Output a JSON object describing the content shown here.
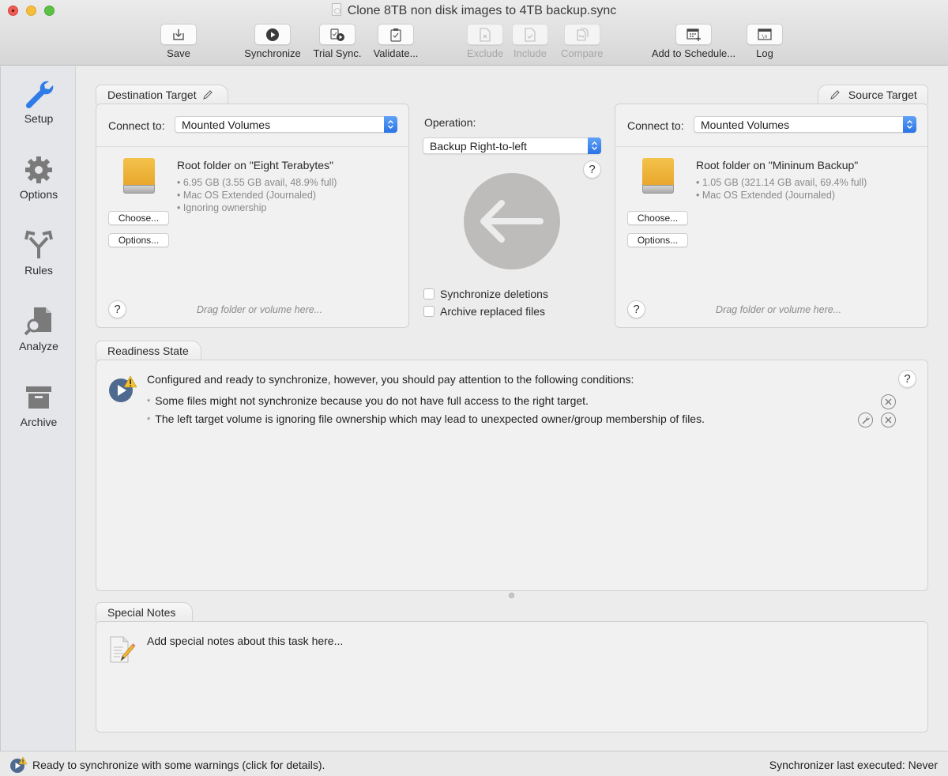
{
  "window": {
    "title": "Clone 8TB non disk images to 4TB backup.sync"
  },
  "toolbar": {
    "items": [
      {
        "label": "Save",
        "icon": "save-icon",
        "enabled": true
      },
      {
        "label": "Synchronize",
        "icon": "play-circle-icon",
        "enabled": true
      },
      {
        "label": "Trial Sync.",
        "icon": "trial-sync-icon",
        "enabled": true
      },
      {
        "label": "Validate...",
        "icon": "clipboard-check-icon",
        "enabled": true
      },
      {
        "label": "Exclude",
        "icon": "document-x-icon",
        "enabled": false
      },
      {
        "label": "Include",
        "icon": "document-check-icon",
        "enabled": false
      },
      {
        "label": "Compare",
        "icon": "compare-documents-icon",
        "enabled": false
      },
      {
        "label": "Add to Schedule...",
        "icon": "calendar-add-icon",
        "enabled": true
      },
      {
        "label": "Log",
        "icon": "log-window-icon",
        "enabled": true
      }
    ]
  },
  "sidebar": {
    "items": [
      {
        "label": "Setup",
        "icon": "wrench-icon",
        "active": true
      },
      {
        "label": "Options",
        "icon": "gear-icon",
        "active": false
      },
      {
        "label": "Rules",
        "icon": "fork-arrows-icon",
        "active": false
      },
      {
        "label": "Analyze",
        "icon": "document-magnifier-icon",
        "active": false
      },
      {
        "label": "Archive",
        "icon": "archive-box-icon",
        "active": false
      }
    ]
  },
  "destination": {
    "tab_label": "Destination Target",
    "connect_label": "Connect to:",
    "connect_value": "Mounted Volumes",
    "volume_title": "Root folder on \"Eight Terabytes\"",
    "details": [
      "• 6.95 GB (3.55 GB avail, 48.9% full)",
      "• Mac OS Extended (Journaled)",
      "• Ignoring ownership"
    ],
    "choose_label": "Choose...",
    "options_label": "Options...",
    "help_label": "?",
    "drag_hint": "Drag folder or volume here..."
  },
  "source": {
    "tab_label": "Source Target",
    "connect_label": "Connect to:",
    "connect_value": "Mounted Volumes",
    "volume_title": "Root folder on \"Mininum Backup\"",
    "details": [
      "• 1.05 GB (321.14 GB avail, 69.4% full)",
      "• Mac OS Extended (Journaled)"
    ],
    "choose_label": "Choose...",
    "options_label": "Options...",
    "help_label": "?",
    "drag_hint": "Drag folder or volume here..."
  },
  "operation": {
    "label": "Operation:",
    "value": "Backup Right-to-left",
    "help_label": "?",
    "direction": "right-to-left",
    "checkboxes": [
      {
        "label": "Synchronize deletions",
        "checked": false
      },
      {
        "label": "Archive replaced files",
        "checked": false
      }
    ]
  },
  "readiness": {
    "tab_label": "Readiness State",
    "message": "Configured and ready to synchronize, however, you should pay attention to the following conditions:",
    "help_label": "?",
    "conditions": [
      {
        "text": "Some files might not synchronize because you do not have full access to the right target.",
        "fixable": false
      },
      {
        "text": "The left target volume is ignoring file ownership which may lead to unexpected owner/group membership of files.",
        "fixable": true
      }
    ]
  },
  "notes": {
    "tab_label": "Special Notes",
    "placeholder": "Add special notes about this task here..."
  },
  "statusbar": {
    "left": "Ready to synchronize with some warnings (click for details).",
    "right": "Synchronizer last executed:  Never"
  },
  "colors": {
    "accent_blue": "#2f7be8",
    "disk_yellow": "#f0b53c",
    "warning_yellow": "#f5c330",
    "status_icon_blue": "#4e6a8f"
  }
}
